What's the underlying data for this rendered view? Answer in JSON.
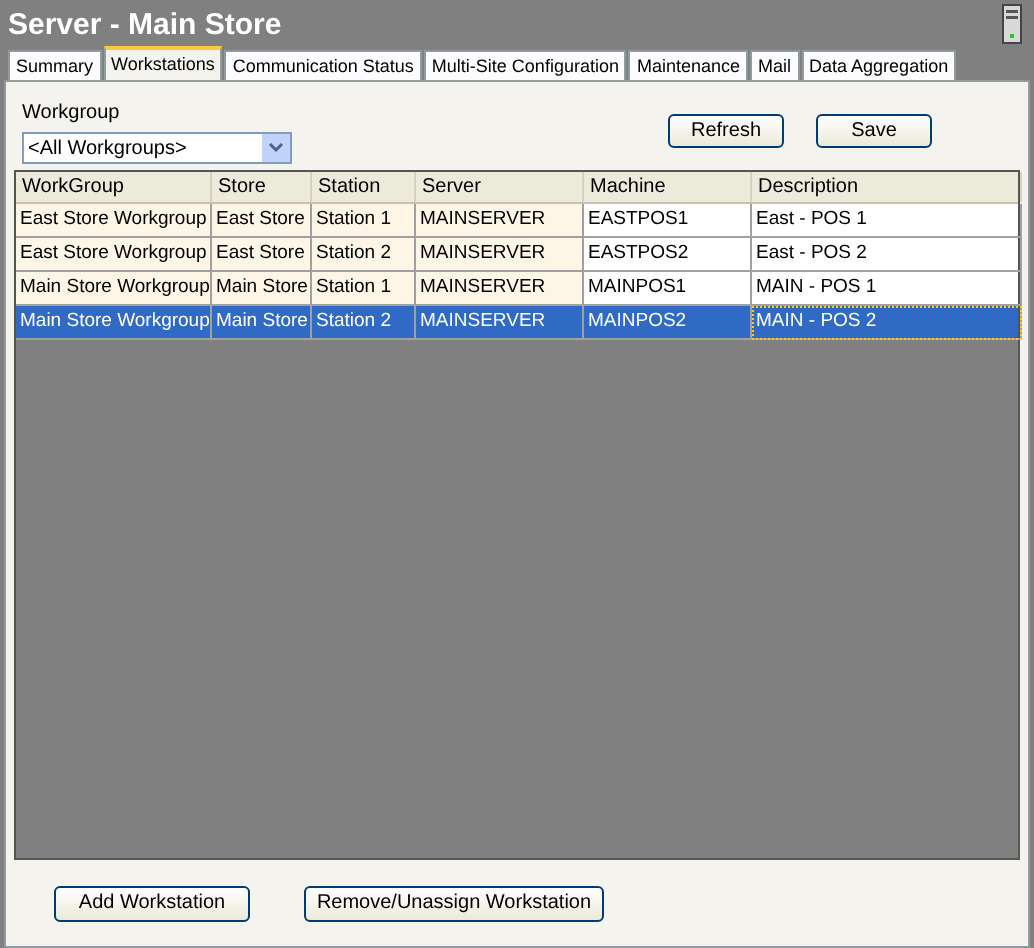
{
  "window": {
    "title": "Server - Main Store"
  },
  "tabs": [
    {
      "label": "Summary",
      "selected": false
    },
    {
      "label": "Workstations",
      "selected": true
    },
    {
      "label": "Communication Status",
      "selected": false
    },
    {
      "label": "Multi-Site Configuration",
      "selected": false
    },
    {
      "label": "Maintenance",
      "selected": false
    },
    {
      "label": "Mail",
      "selected": false
    },
    {
      "label": "Data Aggregation",
      "selected": false
    }
  ],
  "workgroup": {
    "label": "Workgroup",
    "value": "<All Workgroups>"
  },
  "top_buttons": [
    "Refresh",
    "Save"
  ],
  "table": {
    "columns": [
      {
        "label": "WorkGroup",
        "tinted": true
      },
      {
        "label": "Store",
        "tinted": true
      },
      {
        "label": "Station",
        "tinted": true
      },
      {
        "label": "Server",
        "tinted": true
      },
      {
        "label": "Machine",
        "tinted": false
      },
      {
        "label": "Description",
        "tinted": false
      }
    ],
    "rows": [
      {
        "cells": [
          "East Store Workgroup",
          "East Store",
          "Station 1",
          "MAINSERVER",
          "EASTPOS1",
          "East - POS 1"
        ],
        "selected": false
      },
      {
        "cells": [
          "East Store Workgroup",
          "East Store",
          "Station 2",
          "MAINSERVER",
          "EASTPOS2",
          "East - POS 2"
        ],
        "selected": false
      },
      {
        "cells": [
          "Main Store Workgroup",
          "Main Store",
          "Station 1",
          "MAINSERVER",
          "MAINPOS1",
          "MAIN - POS 1"
        ],
        "selected": false
      },
      {
        "cells": [
          "Main Store Workgroup",
          "Main Store",
          "Station 2",
          "MAINSERVER",
          "MAINPOS2",
          "MAIN - POS 2"
        ],
        "selected": true
      }
    ]
  },
  "bottom_buttons": [
    "Add Workstation",
    "Remove/Unassign Workstation"
  ]
}
